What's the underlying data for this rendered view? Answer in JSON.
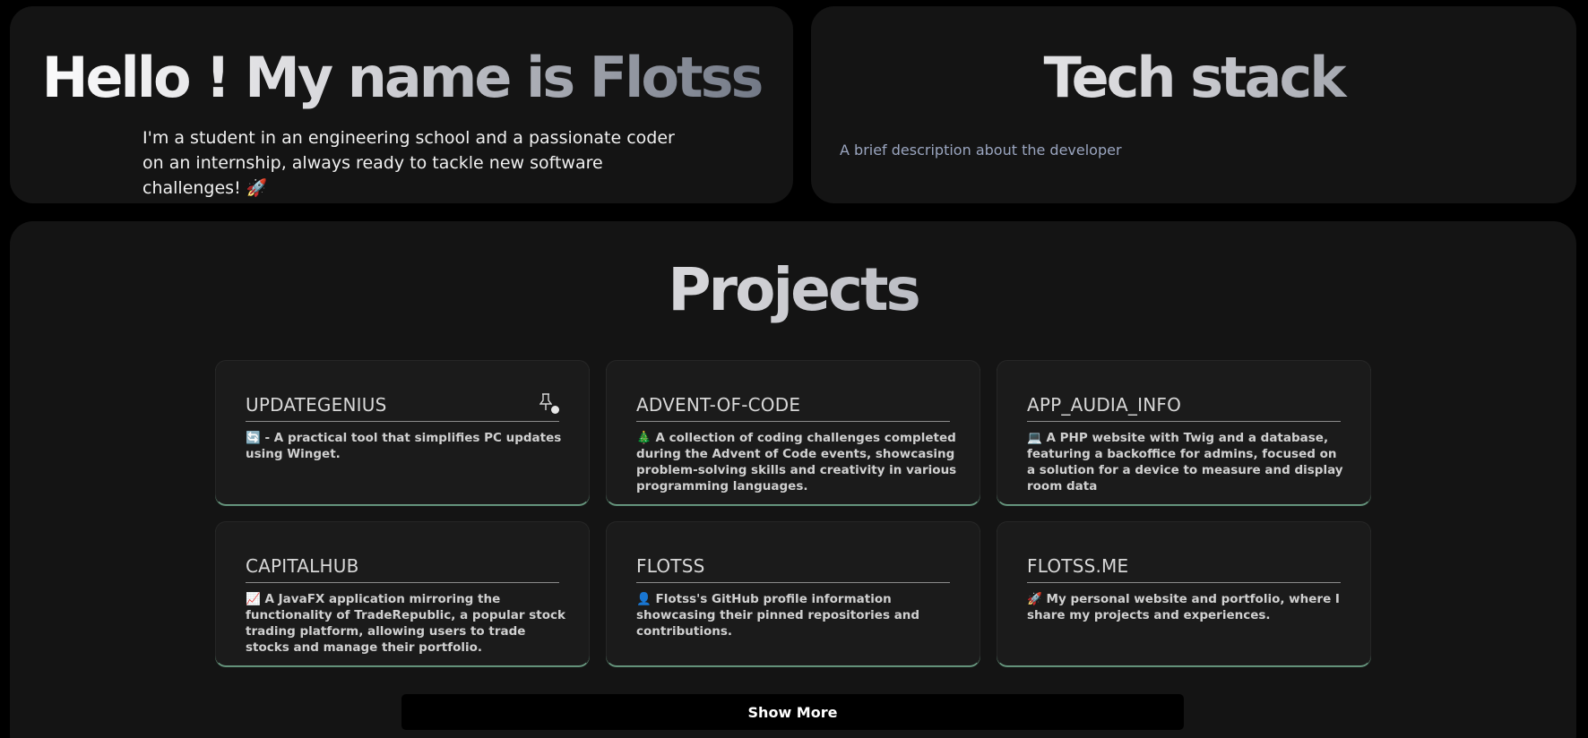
{
  "hello": {
    "title": "Hello ! My name is Flotss",
    "intro": "I'm a student in an engineering school and a passionate coder on an internship, always ready to tackle new software challenges! 🚀"
  },
  "tech": {
    "title": "Tech stack",
    "description": "A brief description about the developer"
  },
  "projects": {
    "title": "Projects",
    "items": [
      {
        "name": "UPDATEGENIUS",
        "description": "🔄 - A practical tool that simplifies PC updates using Winget.",
        "pinned": true
      },
      {
        "name": "ADVENT-OF-CODE",
        "description": "🎄 A collection of coding challenges completed during the Advent of Code events, showcasing problem-solving skills and creativity in various programming languages."
      },
      {
        "name": "APP_AUDIA_INFO",
        "description": "💻 A PHP website with Twig and a database, featuring a backoffice for admins, focused on a solution for a device to measure and display room data"
      },
      {
        "name": "CAPITALHUB",
        "description": "📈 A JavaFX application mirroring the functionality of TradeRepublic, a popular stock trading platform, allowing users to trade stocks and manage their portfolio."
      },
      {
        "name": "FLOTSS",
        "description": "👤 Flotss's GitHub profile information showcasing their pinned repositories and contributions."
      },
      {
        "name": "FLOTSS.ME",
        "description": "🚀 My personal website and portfolio, where I share my projects and experiences."
      }
    ],
    "show_more_label": "Show More"
  },
  "colors": {
    "background": "#000000",
    "panel": "#141414",
    "card": "#1b1b1b",
    "card_accent": "#6f9e86",
    "muted_text": "#9aa5bf"
  },
  "icons": {
    "pin": "pin-icon"
  }
}
